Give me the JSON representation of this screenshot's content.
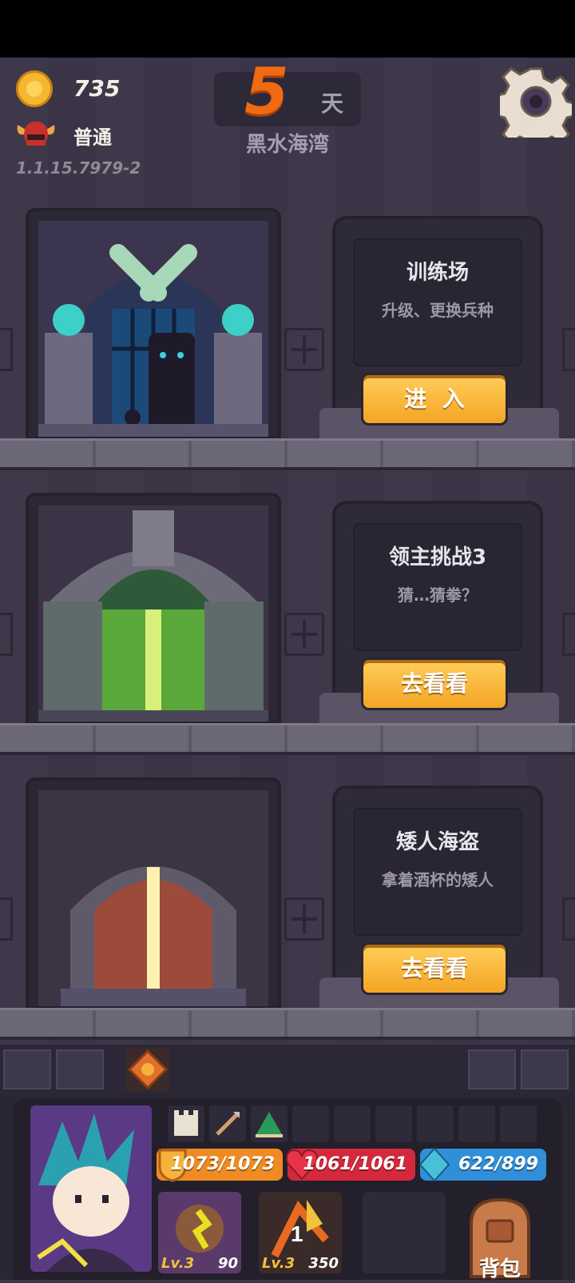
{
  "header": {
    "gold": "735",
    "difficulty": "普通",
    "version": "1.1.15.7979-2",
    "day_number": "5",
    "day_unit": "天",
    "location": "黑水海湾"
  },
  "floors": [
    {
      "title": "训练场",
      "subtitle": "升级、更换兵种",
      "button": "进  入"
    },
    {
      "title": "领主挑战3",
      "subtitle": "猜…猜拳？",
      "button": "去看看"
    },
    {
      "title": "矮人海盗",
      "subtitle": "拿着酒杯的矮人",
      "button": "去看看"
    }
  ],
  "hud": {
    "armor": "1073/1073",
    "health": "1061/1061",
    "mana": "622/899",
    "skills": [
      {
        "level": "Lv.3",
        "cost": "90"
      },
      {
        "level": "Lv.3",
        "cost": "350"
      }
    ],
    "bag_label": "背包"
  },
  "colors": {
    "button": "#f7b23b",
    "armor": "#f08a22",
    "health": "#d4293c",
    "mana": "#2f8fd8",
    "day": "#f06a12"
  }
}
